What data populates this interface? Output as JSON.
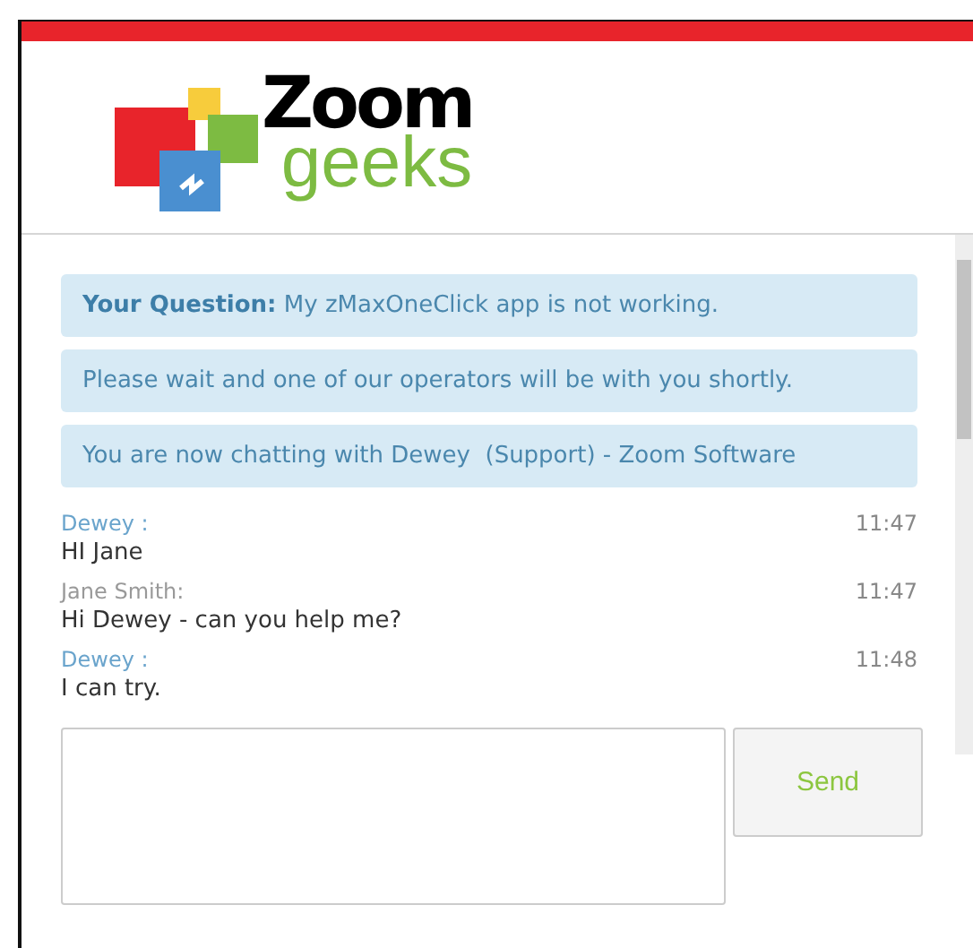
{
  "logo": {
    "word": "Zoom",
    "tagline": "geeks"
  },
  "notices": [
    {
      "text": "**Your Question:** My zMaxOneClick app is not working."
    },
    {
      "text": "Please wait and one of our operators will be with you shortly."
    },
    {
      "text": "You are now chatting with Dewey  (Support) - Zoom Software"
    }
  ],
  "messages": [
    {
      "kind": "agent",
      "sender": "Dewey :",
      "time": "11:47",
      "text": "HI Jane"
    },
    {
      "kind": "visitor",
      "sender": "Jane Smith:",
      "time": "11:47",
      "text": "Hi Dewey - can you help me?"
    },
    {
      "kind": "agent",
      "sender": "Dewey :",
      "time": "11:48",
      "text": "I can try."
    }
  ],
  "composer": {
    "button": "Send"
  }
}
